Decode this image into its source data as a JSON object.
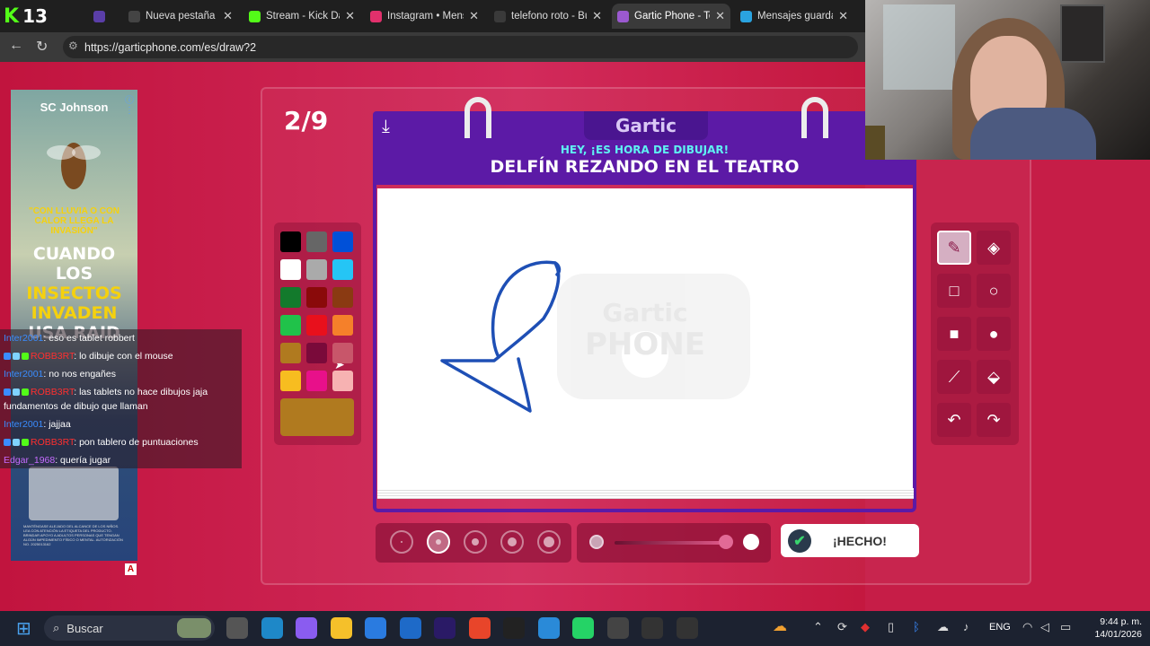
{
  "kick": {
    "badge_count": "13"
  },
  "tabs": [
    {
      "label": "Nueva pestaña",
      "icon": "blank-tab-icon",
      "color": "#444"
    },
    {
      "label": "Stream - Kick Dash",
      "icon": "kick-icon",
      "color": "#53fc18"
    },
    {
      "label": "Instagram • Mensa",
      "icon": "instagram-icon",
      "color": "#e1306c"
    },
    {
      "label": "telefono roto - Bús",
      "icon": "search-icon",
      "color": "#3a3a3a"
    },
    {
      "label": "Gartic Phone - Tele",
      "icon": "gartic-icon",
      "color": "#9b59d0"
    },
    {
      "label": "Mensajes guardad",
      "icon": "telegram-icon",
      "color": "#2aa3e0"
    }
  ],
  "address": {
    "url": "https://garticphone.com/es/draw?2"
  },
  "game": {
    "round": "2/9",
    "logo": "Gartic",
    "subtitle": "HEY, ¡ES HORA DE DIBUJAR!",
    "prompt": "DELFÍN REZANDO EN EL TEATRO",
    "done_label": "¡HECHO!",
    "watermark_top": "Gartic",
    "watermark_bottom": "PHONE",
    "current_color": "#b07a1f",
    "stroke_color": "#1e4fb5",
    "palette": [
      "#000000",
      "#666666",
      "#0050d8",
      "#ffffff",
      "#aaaaaa",
      "#25c5f5",
      "#137a2c",
      "#8a0a0a",
      "#8a3a12",
      "#20c24a",
      "#e8101c",
      "#f5802a",
      "#b07a1f",
      "#7a0a3a",
      "#c8566a",
      "#f7bd20",
      "#e8108a",
      "#f7b2b2"
    ],
    "brush_sizes": 5,
    "selected_size_index": 1,
    "tools": [
      "pencil-tool",
      "eraser-tool",
      "rectangle-outline-tool",
      "ellipse-outline-tool",
      "rectangle-fill-tool",
      "ellipse-fill-tool",
      "line-tool",
      "fill-bucket-tool",
      "undo-tool",
      "redo-tool"
    ]
  },
  "ad": {
    "brand": "SC Johnson",
    "rain_text": "\"CON LLUVIA O CON CALOR LLEGA LA INVASIÓN\"",
    "headline_1": "CUANDO LOS",
    "headline_2": "INSECTOS",
    "headline_3": "INVADEN",
    "headline_4": "USA RAID",
    "fine_print": "MANTÉNGASE ALEJADO DEL ALCANCE DE LOS NIÑOS. LEA CON ATENCIÓN LA ETIQUETA DEL PRODUCTO. BRINDAR APOYO A ADULTOS PERSONAS QUE TENGAN ALGÚN IMPEDIMENTO FÍSICO O MENTAL. AUTORIZACIÓN NO. 2025013162",
    "badge": "A"
  },
  "chat": [
    {
      "user": "Inter2001",
      "text": ": eso es tablet robbert",
      "ucls": "u",
      "badges": false
    },
    {
      "user": "ROBB3RT",
      "text": ": lo dibuje con el mouse",
      "ucls": "u red",
      "badges": true
    },
    {
      "user": "Inter2001",
      "text": ": no nos engañes",
      "ucls": "u",
      "badges": false
    },
    {
      "user": "ROBB3RT",
      "text": ": las tablets no hace dibujos jaja fundamentos de dibujo que llaman",
      "ucls": "u red",
      "badges": true
    },
    {
      "user": "Inter2001",
      "text": ": jajjaa",
      "ucls": "u",
      "badges": false
    },
    {
      "user": "ROBB3RT",
      "text": ": pon tablero de puntuaciones",
      "ucls": "u red",
      "badges": true
    },
    {
      "user": "Edgar_1968",
      "text": ": quería jugar",
      "ucls": "u purple",
      "badges": false
    }
  ],
  "taskbar": {
    "search_label": "Buscar",
    "lang": "ENG",
    "time": "9:44 p. m.",
    "date": "14/01/2026",
    "apps": [
      {
        "name": "task-view-icon",
        "color": "#555"
      },
      {
        "name": "edge-icon",
        "color": "#1e88c8"
      },
      {
        "name": "copilot-icon",
        "color": "#8a5cf0"
      },
      {
        "name": "file-explorer-icon",
        "color": "#f5c02a"
      },
      {
        "name": "store-icon",
        "color": "#2a7be0"
      },
      {
        "name": "outlook-icon",
        "color": "#1e6ac8"
      },
      {
        "name": "premiere-icon",
        "color": "#2a1a66"
      },
      {
        "name": "chrome-icon",
        "color": "#e8452a"
      },
      {
        "name": "capcut-icon",
        "color": "#222"
      },
      {
        "name": "pen-app-icon",
        "color": "#2a8ad8"
      },
      {
        "name": "whatsapp-icon",
        "color": "#25d366"
      },
      {
        "name": "calculator-icon",
        "color": "#444"
      },
      {
        "name": "media-player-icon",
        "color": "#333"
      },
      {
        "name": "obs-icon",
        "color": "#333"
      }
    ]
  }
}
